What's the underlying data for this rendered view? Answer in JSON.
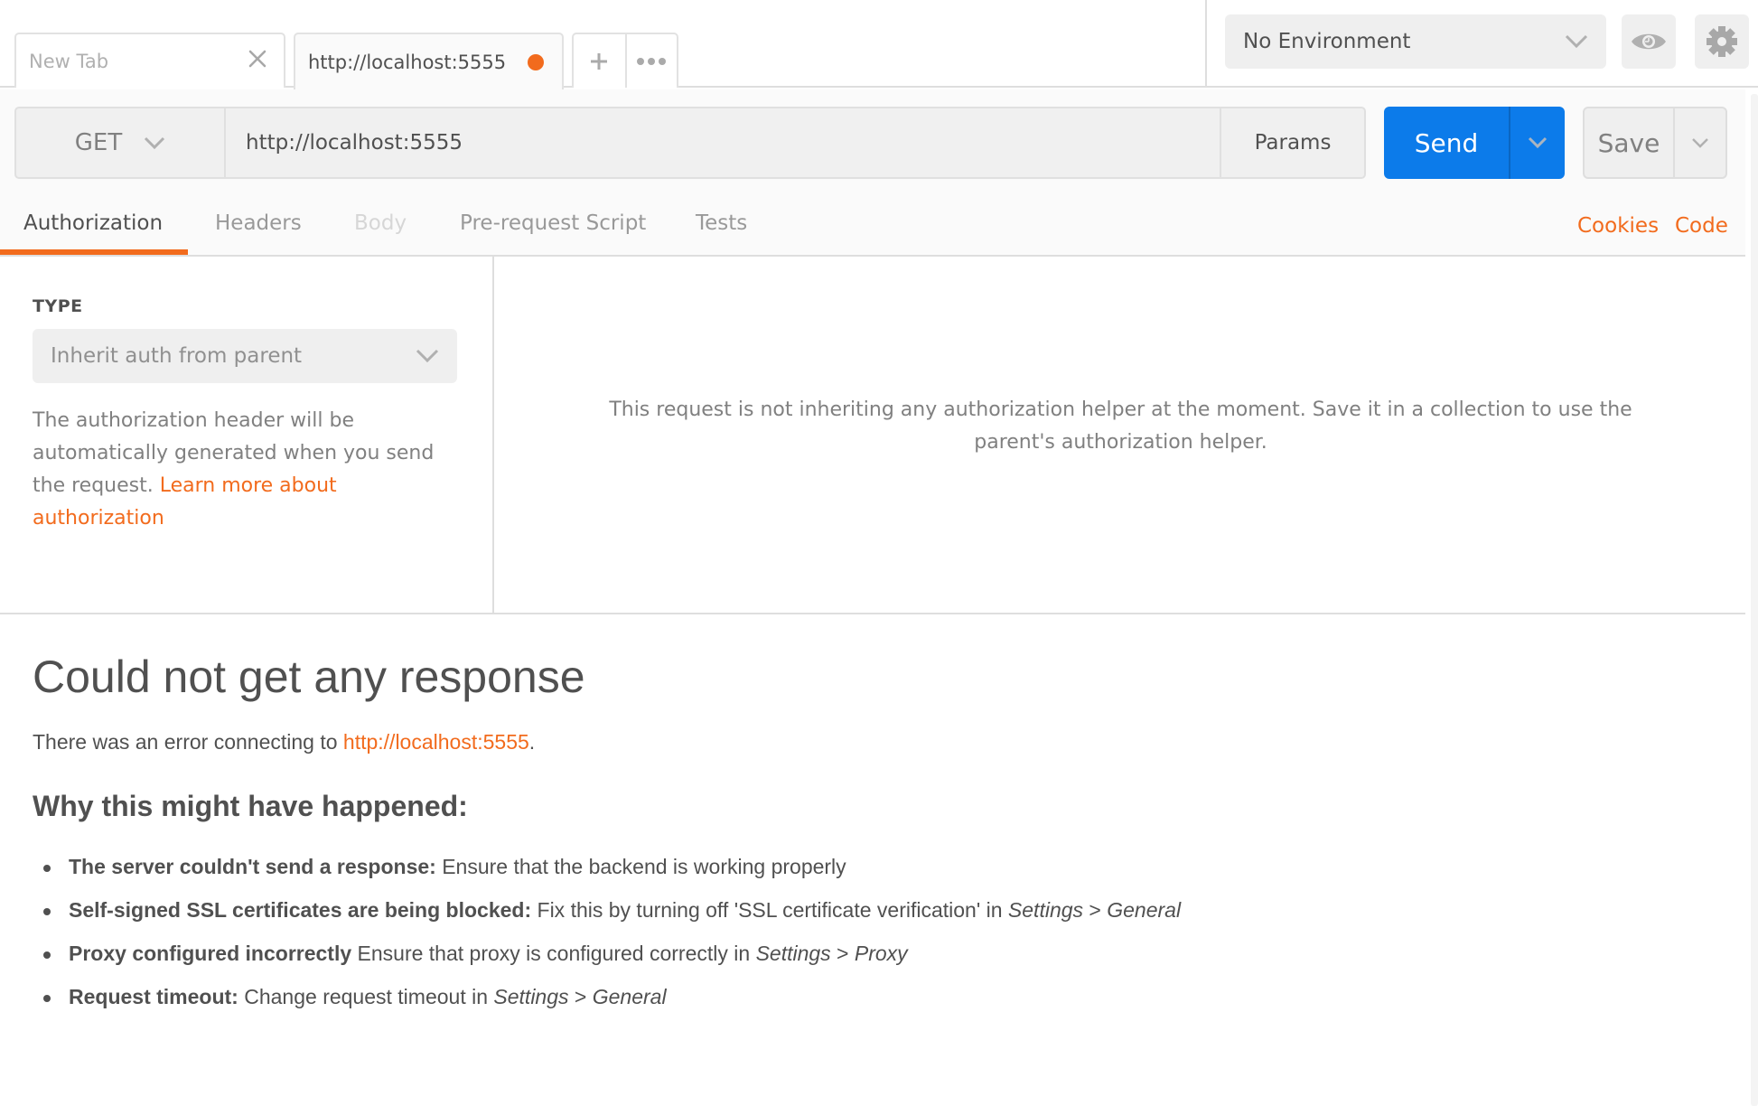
{
  "tabs": {
    "new_tab_label": "New Tab",
    "active_tab_label": "http://localhost:5555",
    "active_tab_unsaved": true,
    "add_tab_icon": "plus-icon",
    "more_tabs_icon": "ellipsis-icon"
  },
  "environment": {
    "selected": "No Environment",
    "quick_look_icon": "eye-icon",
    "settings_icon": "gear-icon"
  },
  "request": {
    "method": "GET",
    "url": "http://localhost:5555",
    "url_placeholder": "Enter request URL",
    "params_label": "Params",
    "send_label": "Send",
    "save_label": "Save"
  },
  "subtabs": {
    "items": [
      {
        "label": "Authorization",
        "state": "active"
      },
      {
        "label": "Headers",
        "state": "normal"
      },
      {
        "label": "Body",
        "state": "disabled"
      },
      {
        "label": "Pre-request Script",
        "state": "normal"
      },
      {
        "label": "Tests",
        "state": "normal"
      }
    ],
    "cookies_label": "Cookies",
    "code_label": "Code"
  },
  "auth": {
    "type_label": "TYPE",
    "type_selected": "Inherit auth from parent",
    "help_text": "The authorization header will be automatically generated when you send the request. ",
    "help_link": "Learn more about authorization",
    "right_message": "This request is not inheriting any authorization helper at the moment. Save it in a collection to use the parent's authorization helper."
  },
  "response": {
    "title": "Could not get any response",
    "error_prefix": "There was an error connecting to ",
    "error_url": "http://localhost:5555",
    "error_suffix": ".",
    "why_heading": "Why this might have happened:",
    "reasons": [
      {
        "bold": "The server couldn't send a response:",
        "text": " Ensure that the backend is working properly",
        "italic1": "",
        "sep": "",
        "italic2": ""
      },
      {
        "bold": "Self-signed SSL certificates are being blocked:",
        "text": " Fix this by turning off 'SSL certificate verification' in ",
        "italic1": "Settings",
        "sep": " > ",
        "italic2": "General"
      },
      {
        "bold": "Proxy configured incorrectly",
        "text": " Ensure that proxy is configured correctly in ",
        "italic1": "Settings",
        "sep": " > ",
        "italic2": "Proxy"
      },
      {
        "bold": "Request timeout:",
        "text": " Change request timeout in ",
        "italic1": "Settings",
        "sep": " > ",
        "italic2": "General"
      }
    ]
  },
  "colors": {
    "accent": "#f26b1d",
    "send_blue": "#0c7bea"
  }
}
